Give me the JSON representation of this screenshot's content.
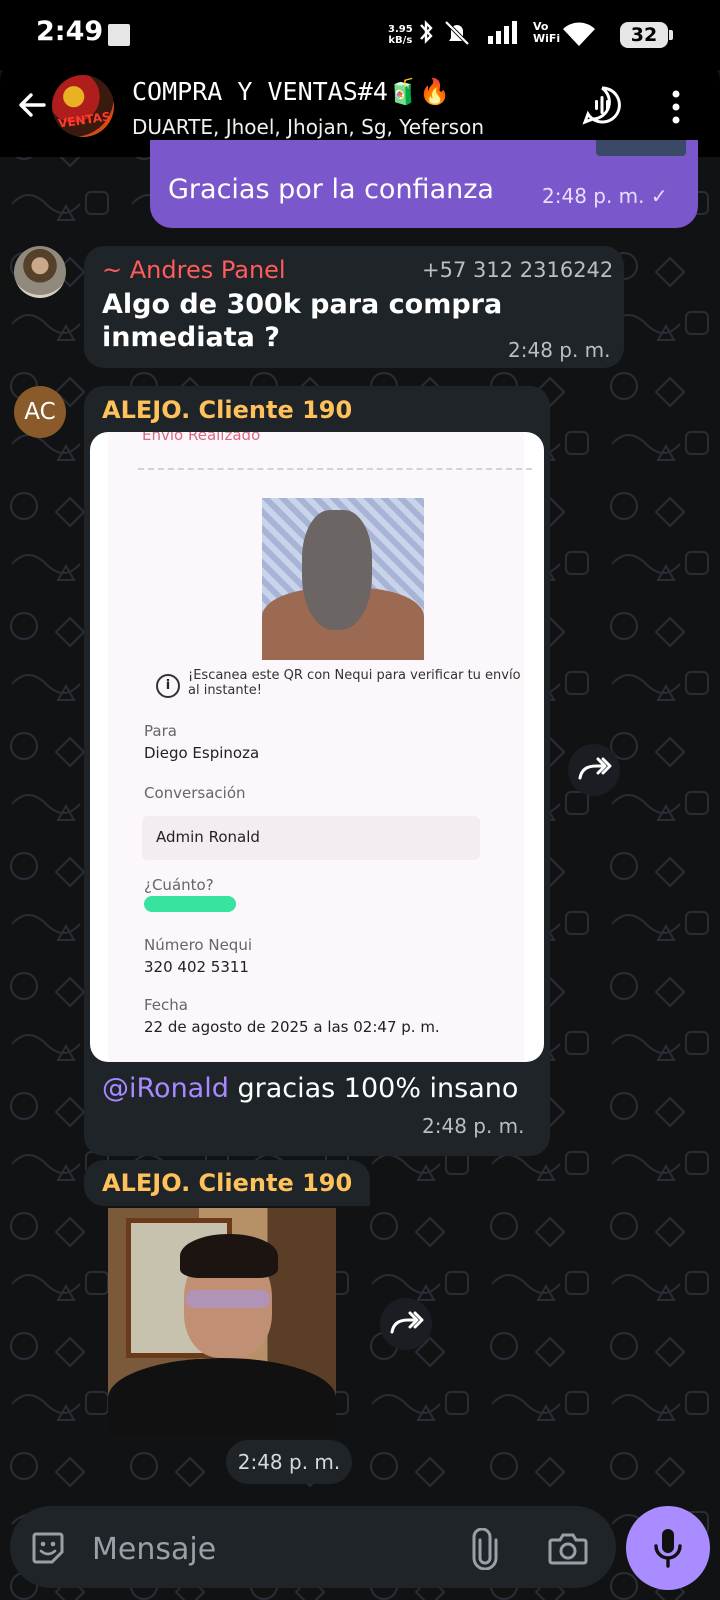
{
  "status_bar": {
    "time": "2:49",
    "net_speed": "3.95",
    "net_unit": "kB/s",
    "vo": "Vo",
    "wifi_label": "WiFi",
    "battery": "32"
  },
  "header": {
    "title": "COMPRA Y VENTAS#4",
    "title_emoji": "🧃🔥",
    "subtitle": "DUARTE, Jhoel, Jhojan, Sg, Yeferson"
  },
  "messages": {
    "outgoing": {
      "text": "Gracias por la confianza",
      "time": "2:48 p. m. ✓"
    },
    "andres": {
      "sender": "~ Andres Panel",
      "phone": "+57 312 2316242",
      "text": "Algo de 300k para compra inmediata ?",
      "time": "2:48 p. m."
    },
    "alejo_receipt": {
      "avatar": "AC",
      "sender": "ALEJO. Cliente 190",
      "receipt": {
        "status": "Envío Realizado",
        "info": "¡Escanea este QR con Nequi para verificar tu envío al instante!",
        "para_label": "Para",
        "para_value": "Diego Espinoza",
        "conv_label": "Conversación",
        "conv_value": "Admin Ronald",
        "amount_label": "¿Cuánto?",
        "nequi_label": "Número Nequi",
        "nequi_value": "320 402 5311",
        "date_label": "Fecha",
        "date_value": "22 de agosto de 2025 a las 02:47 p. m."
      },
      "mention": "@iRonald",
      "caption": " gracias 100% insano",
      "time": "2:48 p. m."
    },
    "alejo_photo": {
      "sender": "ALEJO. Cliente 190",
      "time": "2:48 p. m."
    }
  },
  "input": {
    "placeholder": "Mensaje"
  },
  "colors": {
    "accent": "#a98cff",
    "outgoing_bubble": "#7b57cc",
    "incoming_bubble": "#1f2429",
    "sender_red": "#ff5b5b",
    "sender_gold": "#ffc15a"
  }
}
